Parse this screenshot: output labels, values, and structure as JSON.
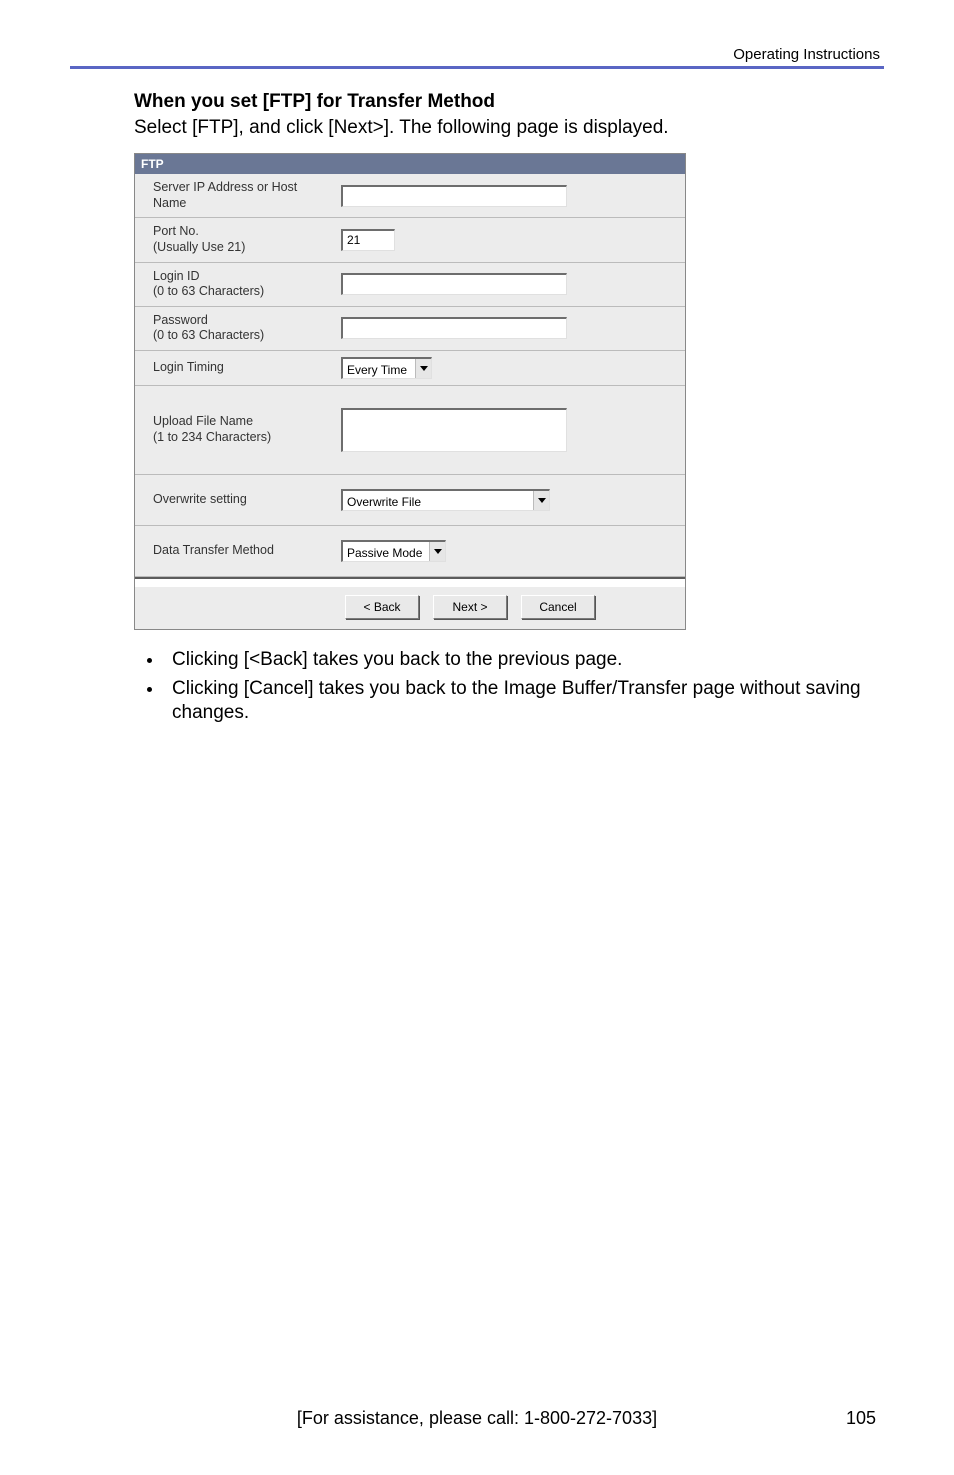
{
  "header": {
    "title": "Operating Instructions"
  },
  "section": {
    "heading": "When you set [FTP] for Transfer Method",
    "subtext": "Select [FTP], and click [Next>]. The following page is displayed."
  },
  "ftp": {
    "title": "FTP",
    "rows": {
      "server": {
        "label1": "Server IP Address or Host",
        "label2": "Name",
        "value": ""
      },
      "port": {
        "label1": "Port No.",
        "label2": "(Usually Use 21)",
        "value": "21"
      },
      "login": {
        "label1": "Login ID",
        "label2": "(0 to 63 Characters)",
        "value": ""
      },
      "password": {
        "label1": "Password",
        "label2": "(0 to 63 Characters)",
        "value": ""
      },
      "timing": {
        "label1": "Login Timing",
        "value": "Every Time"
      },
      "upload": {
        "label1": "Upload File Name",
        "label2": "(1 to 234 Characters)",
        "value": ""
      },
      "overwrite": {
        "label1": "Overwrite setting",
        "value": "Overwrite File"
      },
      "transfer": {
        "label1": "Data Transfer Method",
        "value": "Passive Mode"
      }
    },
    "buttons": {
      "back": "< Back",
      "next": "Next >",
      "cancel": "Cancel"
    }
  },
  "bullets": {
    "b1": "Clicking [<Back] takes you back to the previous page.",
    "b2": "Clicking [Cancel] takes you back to the Image Buffer/Transfer page without saving changes."
  },
  "footer": {
    "assist": "[For assistance, please call: 1-800-272-7033]",
    "pagenum": "105"
  }
}
